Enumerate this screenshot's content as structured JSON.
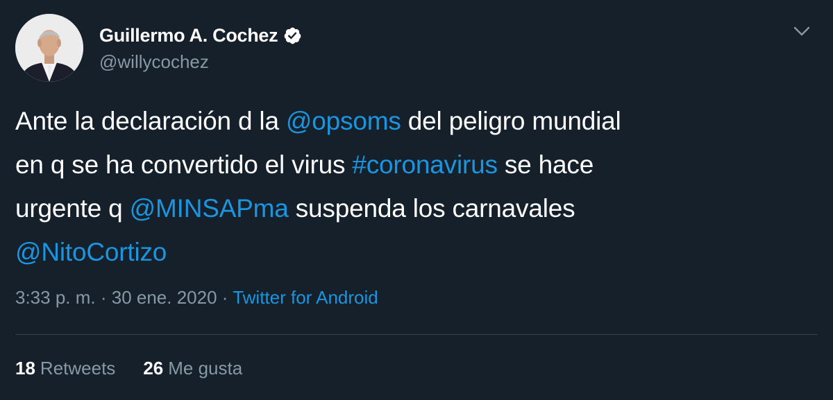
{
  "author": {
    "display_name": "Guillermo A. Cochez",
    "handle": "@willycochez",
    "verified_icon": "verified-badge-icon",
    "avatar_icon": "profile-photo"
  },
  "tweet": {
    "lines": [
      [
        {
          "text": "Ante la declaración d la ",
          "link": false
        },
        {
          "text": "@opsoms",
          "link": true
        },
        {
          "text": " del peligro mundial",
          "link": false
        }
      ],
      [
        {
          "text": "en q se ha convertido el virus ",
          "link": false
        },
        {
          "text": "#coronavirus",
          "link": true
        },
        {
          "text": " se hace",
          "link": false
        }
      ],
      [
        {
          "text": "urgente q ",
          "link": false
        },
        {
          "text": "@MINSAPma",
          "link": true
        },
        {
          "text": " suspenda los carnavales",
          "link": false
        }
      ],
      [
        {
          "text": "@NitoCortizo",
          "link": true
        }
      ]
    ]
  },
  "meta": {
    "time": "3:33 p. m.",
    "separator": " · ",
    "date": "30 ene. 2020",
    "source": "Twitter for Android"
  },
  "stats": {
    "retweets_count": "18",
    "retweets_label": "Retweets",
    "likes_count": "26",
    "likes_label": "Me gusta"
  },
  "menu_icon": "chevron-down-icon",
  "colors": {
    "background": "#15202b",
    "primary_text": "#ffffff",
    "secondary_text": "#8899a6",
    "link": "#1b95e0",
    "divider": "#38444d"
  }
}
